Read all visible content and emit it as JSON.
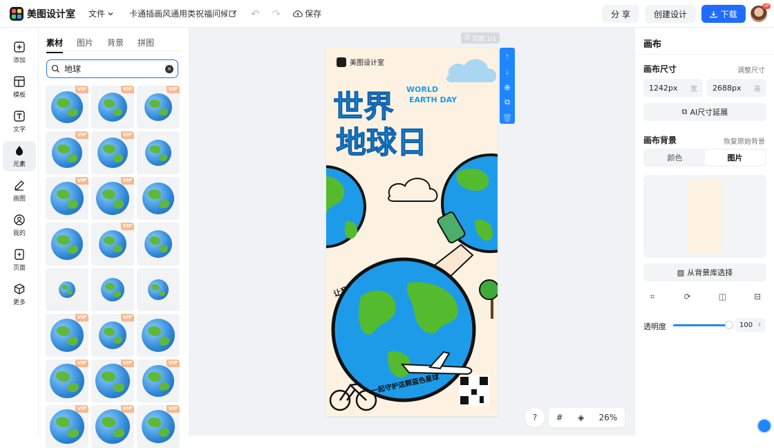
{
  "app": {
    "name": "美图设计室"
  },
  "topbar": {
    "file_menu": "文件",
    "doc_title": "卡通插画风通用类祝福问候...",
    "save_label": "保存",
    "share_label": "分 享",
    "create_label": "创建设计",
    "download_label": "下载",
    "avatar_badge": "VIP"
  },
  "rail": {
    "items": [
      {
        "label": "添加",
        "icon": "plus-square-icon"
      },
      {
        "label": "模板",
        "icon": "template-icon"
      },
      {
        "label": "文字",
        "icon": "text-icon"
      },
      {
        "label": "元素",
        "icon": "shapes-icon"
      },
      {
        "label": "画图",
        "icon": "draw-icon"
      },
      {
        "label": "我的",
        "icon": "user-icon"
      },
      {
        "label": "页面",
        "icon": "page-icon"
      },
      {
        "label": "更多",
        "icon": "cube-icon"
      }
    ],
    "active_index": 3
  },
  "panel": {
    "tabs": [
      "素材",
      "图片",
      "背景",
      "拼图"
    ],
    "active_tab": 0,
    "search_value": "地球",
    "vip_label": "VIP",
    "assets": [
      {
        "kind": "city-globe",
        "vip": true
      },
      {
        "kind": "polluted-earth",
        "vip": true
      },
      {
        "kind": "grey-globe",
        "vip": true
      },
      {
        "kind": "pollution-globe",
        "vip": true
      },
      {
        "kind": "satellite-globe",
        "vip": true
      },
      {
        "kind": "orbit-globe",
        "vip": false
      },
      {
        "kind": "real-earth",
        "vip": true
      },
      {
        "kind": "green-globe",
        "vip": true
      },
      {
        "kind": "flat-globe",
        "vip": false
      },
      {
        "kind": "sketch-globe",
        "vip": false
      },
      {
        "kind": "striped-globe",
        "vip": true
      },
      {
        "kind": "desk-globe",
        "vip": false
      },
      {
        "kind": "small-globe-stand",
        "vip": false
      },
      {
        "kind": "globe-stand",
        "vip": false
      },
      {
        "kind": "blue-globe-stand",
        "vip": false
      },
      {
        "kind": "classic-globe",
        "vip": true
      },
      {
        "kind": "hands-globe",
        "vip": true
      },
      {
        "kind": "ocean-globe",
        "vip": false
      },
      {
        "kind": "smile-globe",
        "vip": true
      },
      {
        "kind": "cute-globe",
        "vip": true
      },
      {
        "kind": "happy-globe",
        "vip": true
      },
      {
        "kind": "face-globe-a",
        "vip": true
      },
      {
        "kind": "face-globe-b",
        "vip": true
      },
      {
        "kind": "face-globe-c",
        "vip": true
      }
    ]
  },
  "canvas": {
    "page_label": "页面 1/1",
    "zoom": "26%",
    "help": "?"
  },
  "poster": {
    "brand": "美图设计室",
    "title_line1": "世界",
    "title_line2": "地球日",
    "en_line1": "WORLD",
    "en_line2": "EARTH DAY",
    "slogan1": "让我们从点滴小事做起",
    "slogan2": "一起守护这颗蓝色星球"
  },
  "right_panel": {
    "title": "画布",
    "size_label": "画布尺寸",
    "resize_link": "调整尺寸",
    "width_value": "1242px",
    "width_unit": "宽",
    "height_value": "2688px",
    "height_unit": "高",
    "ai_extend": "AI尺寸延展",
    "bg_label": "画布背景",
    "reset_bg": "恢复原始背景",
    "seg_color": "颜色",
    "seg_image": "图片",
    "from_library": "从背景库选择",
    "opacity_label": "透明度",
    "opacity_value": "100",
    "opacity_fraction": 1.0,
    "bg_color": "#fdf2e2"
  },
  "colors": {
    "accent": "#1f6cff",
    "poster_bg": "#fdf2e2",
    "poster_blue": "#1e9be8"
  }
}
